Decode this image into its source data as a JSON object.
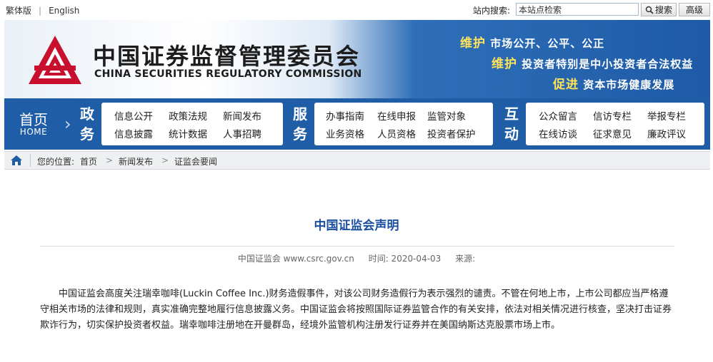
{
  "topbar": {
    "traditional": "繁体版",
    "separator": "|",
    "english": "English",
    "search_label": "站内搜索:",
    "search_placeholder": "本站点检索",
    "search_button": "搜索",
    "advanced_button": "高级"
  },
  "header": {
    "cn_name": "中国证券监督管理委员会",
    "en_name": "CHINA SECURITIES REGULATORY COMMISSION",
    "slogans": [
      {
        "lead": "维护",
        "rest": "市场公开、公平、公正"
      },
      {
        "lead": "维护",
        "rest": "投资者特别是中小投资者合法权益"
      },
      {
        "lead": "促进",
        "rest": "资本市场健康发展"
      }
    ]
  },
  "nav": {
    "home_cn": "首页",
    "home_en": "HOME",
    "sections": [
      {
        "c1": "政",
        "c2": "务",
        "links": [
          "信息公开",
          "政策法规",
          "新闻发布",
          "信息披露",
          "统计数据",
          "人事招聘"
        ]
      },
      {
        "c1": "服",
        "c2": "务",
        "links": [
          "办事指南",
          "在线申报",
          "监管对象",
          "业务资格",
          "人员资格",
          "投资者保护"
        ]
      },
      {
        "c1": "互",
        "c2": "动",
        "links": [
          "公众留言",
          "信访专栏",
          "举报专栏",
          "在线访谈",
          "征求意见",
          "廉政评议"
        ]
      }
    ]
  },
  "breadcrumb": {
    "prefix": "您的位置:",
    "items": [
      "首页",
      "新闻发布",
      "证监会要闻"
    ],
    "separator": ">"
  },
  "article": {
    "title": "中国证监会声明",
    "source": "中国证监会 www.csrc.gov.cn",
    "time": "时间: 2020-04-03",
    "origin": "来源:",
    "body": "中国证监会高度关注瑞幸咖啡(Luckin Coffee Inc.)财务造假事件，对该公司财务造假行为表示强烈的谴责。不管在何地上市，上市公司都应当严格遵守相关市场的法律和规则，真实准确完整地履行信息披露义务。中国证监会将按照国际证券监管合作的有关安排，依法对相关情况进行核查，坚决打击证券欺诈行为，切实保护投资者权益。瑞幸咖啡注册地在开曼群岛，经境外监管机构注册发行证券并在美国纳斯达克股票市场上市。"
  },
  "colors": {
    "nav_blue": "#1f5ea7",
    "title_blue": "#1a4fa0",
    "logo_red": "#c8102e",
    "slogan_highlight": "#ffe35a"
  },
  "icons": [
    "search-icon",
    "home-icon",
    "csrc-logo",
    "chevron-right-icon"
  ]
}
